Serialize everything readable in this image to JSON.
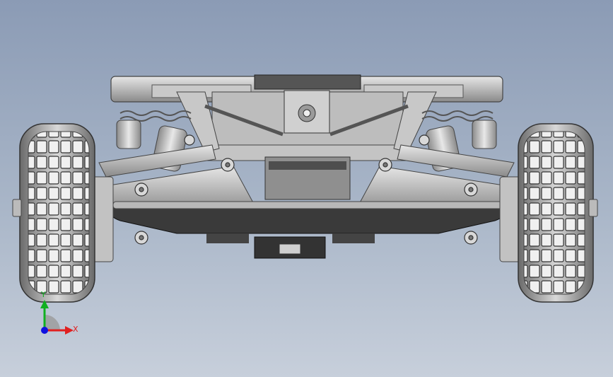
{
  "viewport": {
    "model": "rc-car-chassis-front-view",
    "background_top": "#8b9bb5",
    "background_bottom": "#c7cfdb"
  },
  "triad": {
    "x_label": "X",
    "y_label": "Y",
    "x_color": "#e02020",
    "y_color": "#10b020",
    "z_color": "#1010e0"
  }
}
